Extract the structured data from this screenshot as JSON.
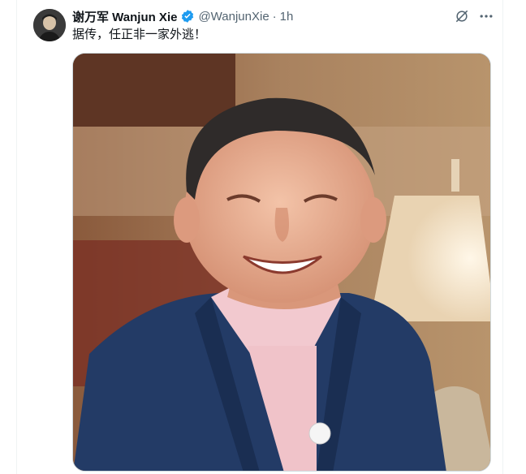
{
  "author": {
    "display_name": "谢万军 Wanjun Xie",
    "handle": "@WanjunXie",
    "separator": "·",
    "time": "1h",
    "verified": true
  },
  "tweet": {
    "text": "据传，任正非一家外逃！"
  },
  "icons": {
    "verified": "verified-badge-icon",
    "grok": "grok-icon",
    "more": "more-icon"
  },
  "colors": {
    "verified": "#1d9bf0",
    "secondary_text": "#536471",
    "primary_text": "#0f1419"
  },
  "media": {
    "type": "photo",
    "subject": "smiling man in navy blazer and pink shirt with a lamp in background"
  }
}
